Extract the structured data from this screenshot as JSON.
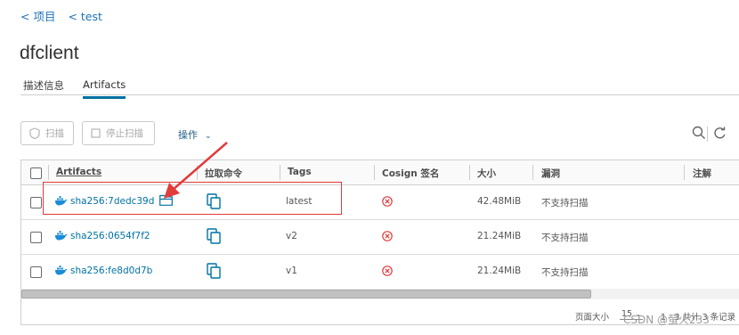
{
  "breadcrumb": [
    "< 项目",
    "< test"
  ],
  "page_title": "dfclient",
  "tabs": [
    "描述信息",
    "Artifacts"
  ],
  "toolbar": {
    "scan": "扫描",
    "stop_scan": "停止扫描",
    "actions": "操作"
  },
  "table": {
    "headers": [
      "Artifacts",
      "拉取命令",
      "Tags",
      "Cosign 签名",
      "大小",
      "漏洞",
      "注解"
    ],
    "rows": [
      {
        "digest": "sha256:7dedc39d",
        "tag": "latest",
        "size": "42.48MiB",
        "vuln": "不支持扫描"
      },
      {
        "digest": "sha256:0654f7f2",
        "tag": "v2",
        "size": "21.24MiB",
        "vuln": "不支持扫描"
      },
      {
        "digest": "sha256:fe8d0d7b",
        "tag": "v1",
        "size": "21.24MiB",
        "vuln": "不支持扫描"
      }
    ]
  },
  "footer": {
    "page_size_label": "页面大小",
    "page_size": "15",
    "summary": "1 - 3 共计 3 条记录"
  },
  "watermark": "CSDN @萤火233",
  "colors": {
    "link": "#0072a3",
    "error": "#e23b3b",
    "annotation": "#e23b3b"
  },
  "icons": {
    "artifact": "docker-whale-icon",
    "pull": "copy-icon",
    "cosign": "x-circle-icon"
  }
}
